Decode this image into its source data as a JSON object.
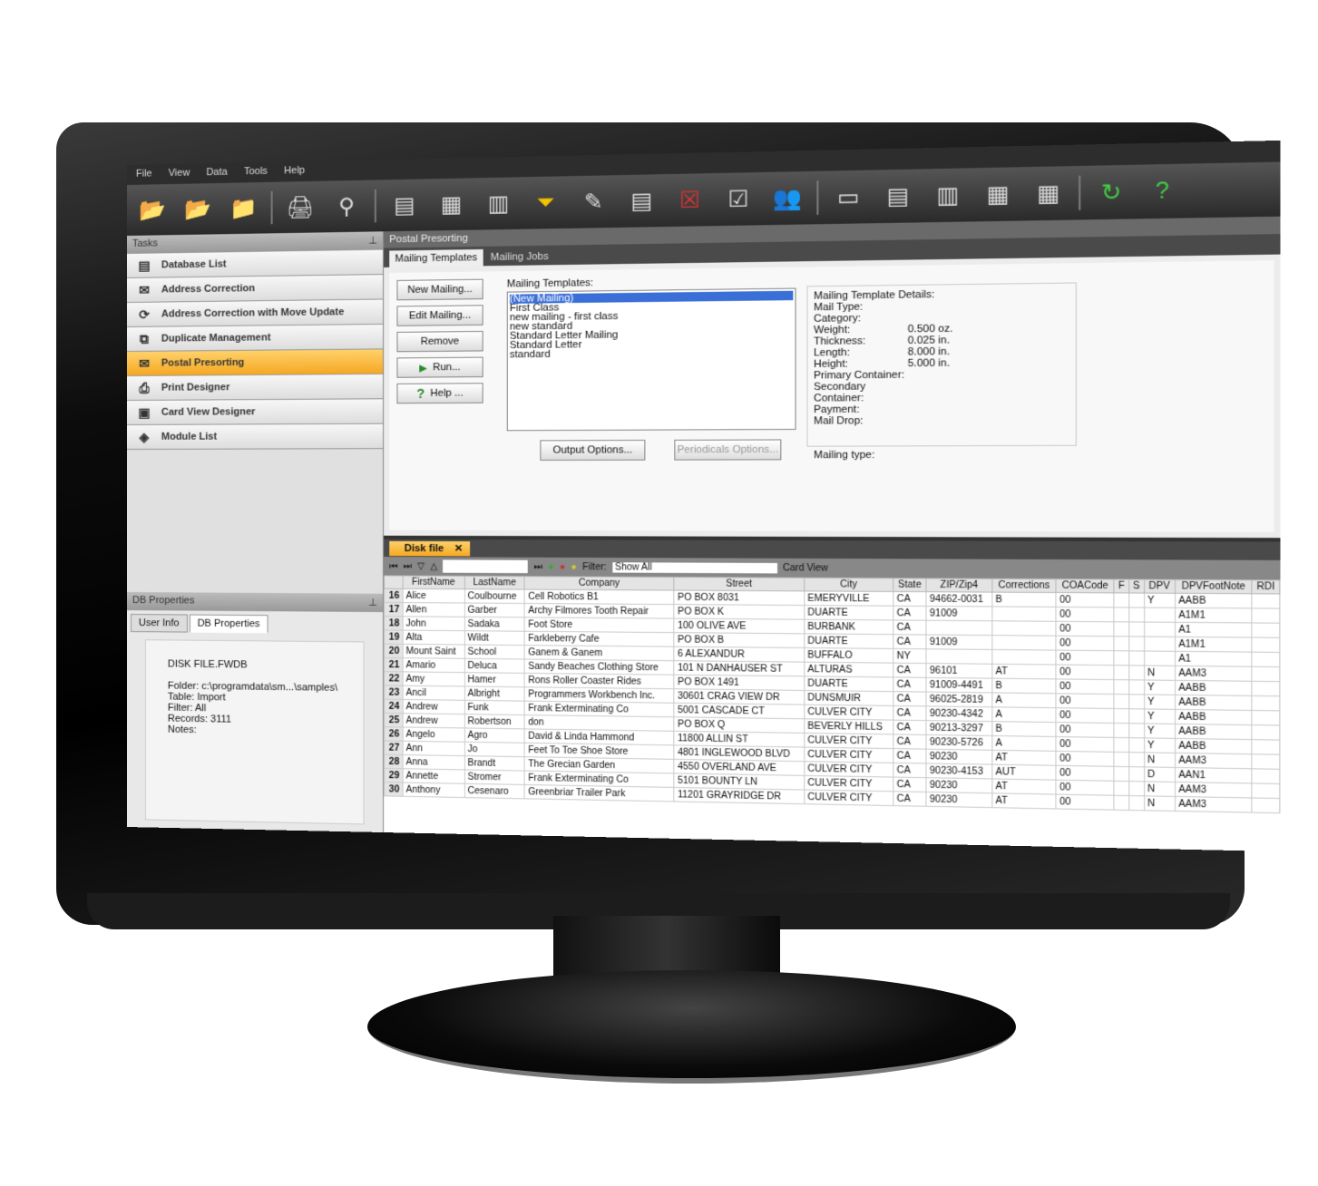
{
  "menu": [
    "File",
    "View",
    "Data",
    "Tools",
    "Help"
  ],
  "toolbar_icons": [
    "import-folder-icon",
    "export-folder-icon",
    "folder-icon",
    "print-icon",
    "search-icon",
    "database-icon",
    "table-icon",
    "columns-icon",
    "filter-icon",
    "edit-icon",
    "notes-icon",
    "delete-icon",
    "checklist-icon",
    "users-icon",
    "layout-1-icon",
    "layout-2-icon",
    "layout-3-icon",
    "layout-4-icon",
    "layout-5-icon",
    "refresh-icon",
    "help-icon"
  ],
  "tasks": {
    "header": "Tasks",
    "items": [
      {
        "label": "Database List",
        "icon": "database-icon"
      },
      {
        "label": "Address Correction",
        "icon": "address-icon"
      },
      {
        "label": "Address Correction with Move Update",
        "icon": "move-update-icon"
      },
      {
        "label": "Duplicate Management",
        "icon": "duplicates-icon"
      },
      {
        "label": "Postal Presorting",
        "icon": "postal-icon",
        "active": true
      },
      {
        "label": "Print Designer",
        "icon": "print-designer-icon"
      },
      {
        "label": "Card View Designer",
        "icon": "card-view-icon"
      },
      {
        "label": "Module List",
        "icon": "modules-icon"
      }
    ]
  },
  "db_properties": {
    "header": "DB Properties",
    "tabs": [
      "User Info",
      "DB Properties"
    ],
    "file": "DISK FILE.FWDB",
    "folder": "Folder: c:\\programdata\\sm...\\samples\\",
    "table": "Table: Import",
    "filter": "Filter: All",
    "records": "Records: 3111",
    "notes": "Notes:"
  },
  "postal": {
    "title": "Postal Presorting",
    "tabs": [
      "Mailing Templates",
      "Mailing Jobs"
    ],
    "buttons": [
      "New Mailing...",
      "Edit Mailing...",
      "Remove",
      "Run...",
      "Help ..."
    ],
    "templates_label": "Mailing Templates:",
    "templates": [
      "(New Mailing)",
      "First Class",
      "new mailing - first class",
      "new standard",
      "Standard Letter Mailing",
      "Standard Letter",
      "standard"
    ],
    "output_options": "Output Options...",
    "periodicals_options": "Periodicals Options...",
    "details": {
      "title": "Mailing Template Details:",
      "rows": [
        [
          "Mail Type:",
          ""
        ],
        [
          "Category:",
          ""
        ],
        [
          "Weight:",
          "0.500 oz."
        ],
        [
          "Thickness:",
          "0.025 in."
        ],
        [
          "Length:",
          "8.000 in."
        ],
        [
          "Height:",
          "5.000 in."
        ],
        [
          "Primary Container:",
          ""
        ],
        [
          "Secondary Container:",
          ""
        ],
        [
          "Payment:",
          ""
        ],
        [
          "Mail Drop:",
          ""
        ]
      ],
      "mailing_type": "Mailing type:"
    }
  },
  "grid": {
    "tab": "Disk file",
    "filter_label": "Filter:",
    "filter_value": "Show All",
    "card_view": "Card View",
    "columns": [
      "",
      "FirstName",
      "LastName",
      "Company",
      "Street",
      "City",
      "State",
      "ZIP/Zip4",
      "Corrections",
      "COACode",
      "F",
      "S",
      "DPV",
      "DPVFootNote",
      "RDI"
    ],
    "rows": [
      [
        "16",
        "Alice",
        "Coulbourne",
        "Cell Robotics B1",
        "PO BOX 8031",
        "EMERYVILLE",
        "CA",
        "94662-0031",
        "B",
        "00",
        "",
        "",
        "Y",
        "AABB",
        ""
      ],
      [
        "17",
        "Allen",
        "Garber",
        "Archy Filmores Tooth Repair",
        "PO BOX K",
        "DUARTE",
        "CA",
        "91009",
        "",
        "00",
        "",
        "",
        "",
        "A1M1",
        ""
      ],
      [
        "18",
        "John",
        "Sadaka",
        "Foot Store",
        "100 OLIVE AVE",
        "BURBANK",
        "CA",
        "",
        "",
        "00",
        "",
        "",
        "",
        "A1",
        ""
      ],
      [
        "19",
        "Alta",
        "Wildt",
        "Farkleberry Cafe",
        "PO BOX B",
        "DUARTE",
        "CA",
        "91009",
        "",
        "00",
        "",
        "",
        "",
        "A1M1",
        ""
      ],
      [
        "20",
        "Mount Saint",
        "School",
        "Ganem & Ganem",
        "6 ALEXANDUR",
        "BUFFALO",
        "NY",
        "",
        "",
        "00",
        "",
        "",
        "",
        "A1",
        ""
      ],
      [
        "21",
        "Amario",
        "Deluca",
        "Sandy Beaches Clothing Store",
        "101 N DANHAUSER ST",
        "ALTURAS",
        "CA",
        "96101",
        "AT",
        "00",
        "",
        "",
        "N",
        "AAM3",
        ""
      ],
      [
        "22",
        "Amy",
        "Hamer",
        "Rons Roller Coaster Rides",
        "PO BOX 1491",
        "DUARTE",
        "CA",
        "91009-4491",
        "B",
        "00",
        "",
        "",
        "Y",
        "AABB",
        ""
      ],
      [
        "23",
        "Ancil",
        "Albright",
        "Programmers Workbench Inc.",
        "30601 CRAG VIEW DR",
        "DUNSMUIR",
        "CA",
        "96025-2819",
        "A",
        "00",
        "",
        "",
        "Y",
        "AABB",
        ""
      ],
      [
        "24",
        "Andrew",
        "Funk",
        "Frank Exterminating Co",
        "5001 CASCADE CT",
        "CULVER CITY",
        "CA",
        "90230-4342",
        "A",
        "00",
        "",
        "",
        "Y",
        "AABB",
        ""
      ],
      [
        "25",
        "Andrew",
        "Robertson",
        "don",
        "PO BOX Q",
        "BEVERLY HILLS",
        "CA",
        "90213-3297",
        "B",
        "00",
        "",
        "",
        "Y",
        "AABB",
        ""
      ],
      [
        "26",
        "Angelo",
        "Agro",
        "David & Linda Hammond",
        "11800 ALLIN ST",
        "CULVER CITY",
        "CA",
        "90230-5726",
        "A",
        "00",
        "",
        "",
        "Y",
        "AABB",
        ""
      ],
      [
        "27",
        "Ann",
        "Jo",
        "Feet To Toe Shoe Store",
        "4801 INGLEWOOD BLVD",
        "CULVER CITY",
        "CA",
        "90230",
        "AT",
        "00",
        "",
        "",
        "N",
        "AAM3",
        ""
      ],
      [
        "28",
        "Anna",
        "Brandt",
        "The Grecian Garden",
        "4550 OVERLAND AVE",
        "CULVER CITY",
        "CA",
        "90230-4153",
        "AUT",
        "00",
        "",
        "",
        "D",
        "AAN1",
        ""
      ],
      [
        "29",
        "Annette",
        "Stromer",
        "Frank Exterminating Co",
        "5101 BOUNTY LN",
        "CULVER CITY",
        "CA",
        "90230",
        "AT",
        "00",
        "",
        "",
        "N",
        "AAM3",
        ""
      ],
      [
        "30",
        "Anthony",
        "Cesenaro",
        "Greenbriar Trailer Park",
        "11201 GRAYRIDGE DR",
        "CULVER CITY",
        "CA",
        "90230",
        "AT",
        "00",
        "",
        "",
        "N",
        "AAM3",
        ""
      ]
    ]
  }
}
